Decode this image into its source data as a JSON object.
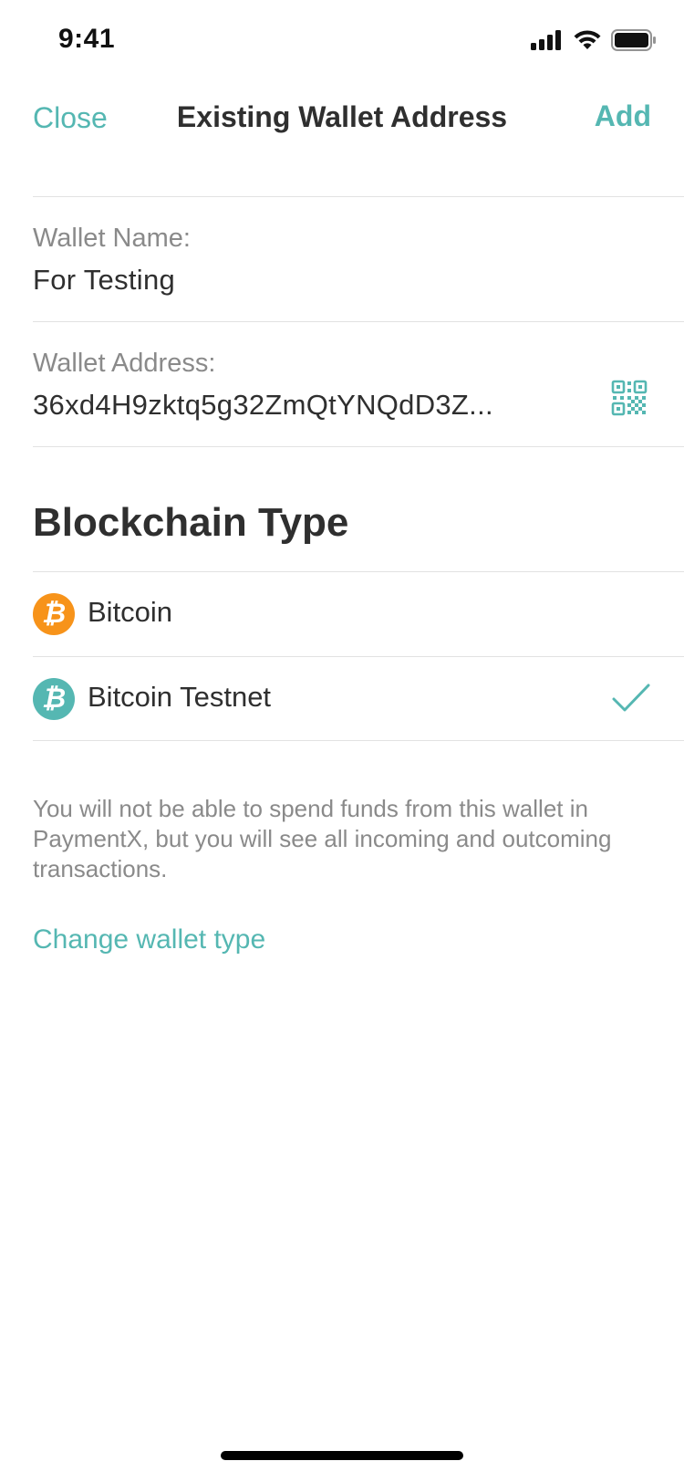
{
  "status_bar": {
    "time": "9:41",
    "icons": [
      "cellular-signal-icon",
      "wifi-icon",
      "battery-icon"
    ]
  },
  "nav": {
    "close_label": "Close",
    "title": "Existing Wallet Address",
    "add_label": "Add"
  },
  "wallet_name": {
    "label": "Wallet Name:",
    "value": "For Testing"
  },
  "wallet_address": {
    "label": "Wallet Address:",
    "value": "36xd4H9zktq5g32ZmQtYNQdD3Z...",
    "action_icon": "qr-code-icon"
  },
  "blockchain": {
    "title": "Blockchain Type",
    "options": [
      {
        "label": "Bitcoin",
        "icon": "bitcoin-icon",
        "color": "#f7931a",
        "selected": false
      },
      {
        "label": "Bitcoin Testnet",
        "icon": "bitcoin-testnet-icon",
        "color": "#55b7b2",
        "selected": true
      }
    ]
  },
  "info_text": "You will not be able to spend funds from this wallet in PaymentX, but you will see all incoming and outcoming transactions.",
  "change_wallet_type_label": "Change wallet type",
  "colors": {
    "accent": "#55b7b2",
    "bitcoin": "#f7931a",
    "text": "#2f2f2f",
    "secondary_text": "#8a8a8a",
    "divider": "#e2e2e2"
  }
}
